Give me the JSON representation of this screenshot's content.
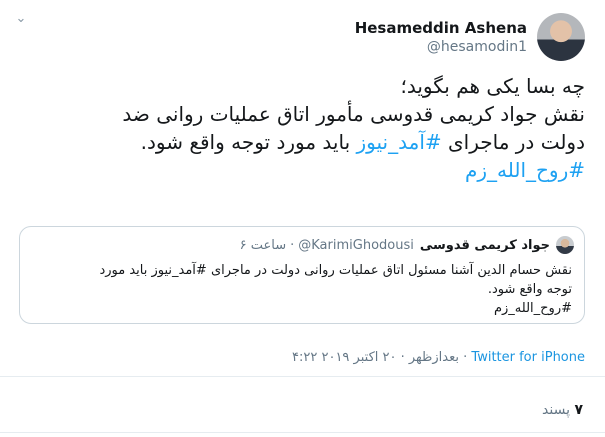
{
  "tweet": {
    "author": {
      "name": "Hesameddin Ashena",
      "handle": "@hesamodin1"
    },
    "lines": [
      "چه بسا یکی هم بگوید؛",
      "نقش جواد کریمی قدوسی مأمور اتاق عملیات روانی ضد",
      "دولت در ماجرای",
      "#آمد_نیوز",
      "باید مورد توجه واقع شود.",
      "#روح_الله_زم"
    ]
  },
  "quoted_tweet": {
    "author_name": "جواد کریمی قدوسی",
    "handle": "@KarimiGhodousi",
    "separator": "·",
    "time": "۶ ساعت",
    "lines": [
      "نقش حسام الدین آشنا مسئول اتاق عملیات روانی دولت در ماجرای #آمد_نیوز باید مورد",
      "توجه واقع شود.",
      "#روح_الله_زم"
    ]
  },
  "meta": {
    "time": "۴:۲۲ بعدازظهر · ۲۰ اکتبر ۲۰۱۹ · ",
    "source": "Twitter for iPhone"
  },
  "likes": {
    "count": "۷",
    "label": "پسند"
  },
  "icons": {
    "menu": "chevron-down-icon"
  }
}
